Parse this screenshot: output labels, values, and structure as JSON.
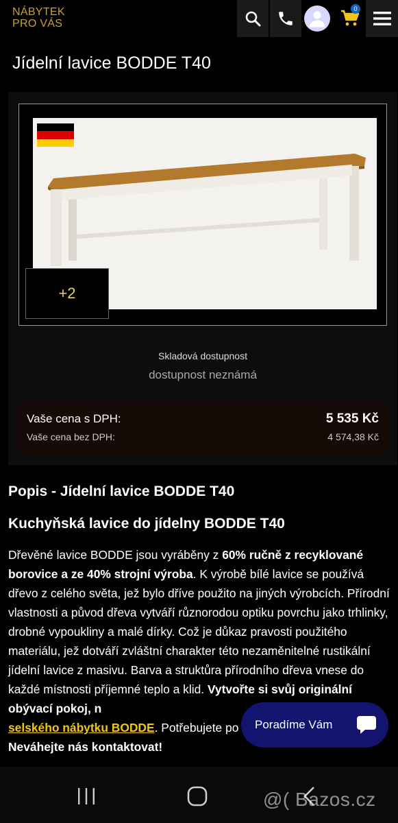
{
  "header": {
    "logo_line1": "NÁBYTEK",
    "logo_line2": "PRO VÁS",
    "cart_count": "0",
    "icons": [
      "search-icon",
      "phone-icon",
      "user-icon",
      "cart-icon",
      "menu-icon"
    ]
  },
  "product": {
    "title": "Jídelní lavice BODDE T40",
    "more_images": "+2",
    "flag": "germany",
    "stock_label": "Skladová dostupnost",
    "stock_value": "dostupnost neznámá",
    "price_with_vat_label": "Vaše cena s DPH:",
    "price_with_vat": "5 535 Kč",
    "price_without_vat_label": "Vaše cena bez DPH:",
    "price_without_vat": "4 574,38 Kč"
  },
  "description": {
    "heading1": "Popis - Jídelní lavice BODDE T40",
    "heading2": "Kuchyňská lavice do jídelny BODDE T40",
    "p1_a": "Dřevěné lavice BODDE jsou vyráběny z ",
    "p1_b": "60% ručně z recyklované borovice a ze 40% strojní výroba",
    "p1_c": ". K výrobě bílé lavice se používá dřevo z celého světa, jež bylo dříve použito na jiných výrobcích. Přírodní vlastnosti a původ dřeva vytváří různorodou optiku povrchu jako trhlinky, drobné vypoukliny a malé dírky. Což je důkaz pravosti použitého materiálu, jež dotváří zvláštní charakter této nezaměnitelné rustikální jídelní lavice z masivu. Barva a struktůra přírodního dřeva vnese do každé místnosti příjemné teplo a klid. ",
    "p1_d": "Vytvořte si svůj originální obývací pokoj, n",
    "p1_link": "selského nábytku BODDE",
    "p1_e": ". Potřebujete po",
    "p1_f": "Neváhejte nás kontaktovat!"
  },
  "chat": {
    "label": "Poradíme Vám"
  },
  "system": {
    "watermark": "@( Bazos.cz"
  },
  "colors": {
    "logo": "#c9a227",
    "price_box": "#150a05",
    "chat": "#12146e",
    "link": "#f0c419"
  }
}
